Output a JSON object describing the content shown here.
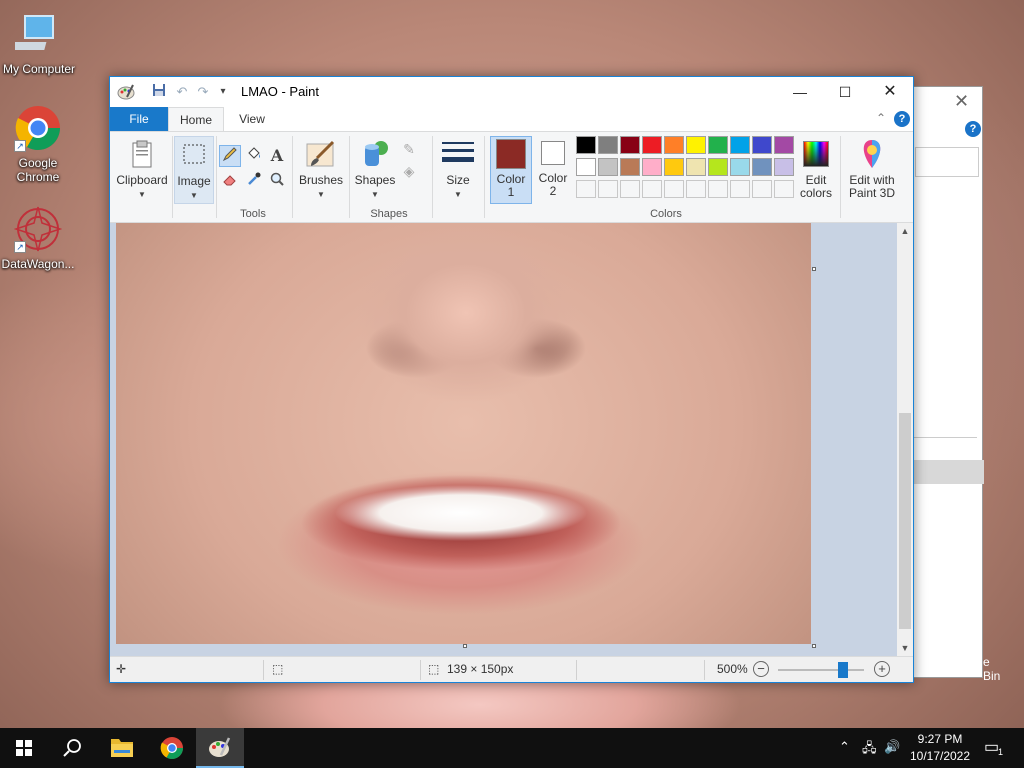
{
  "desktop": {
    "icons": [
      {
        "label": "My Computer"
      },
      {
        "label": "Google Chrome"
      },
      {
        "label": "DataWagon..."
      }
    ],
    "recycle_bin_label": "e Bin"
  },
  "paint": {
    "title": "LMAO - Paint",
    "tabs": {
      "file": "File",
      "home": "Home",
      "view": "View"
    },
    "ribbon": {
      "clipboard": "Clipboard",
      "image": "Image",
      "tools_group": "Tools",
      "brushes": "Brushes",
      "shapes": "Shapes",
      "shapes_group": "Shapes",
      "size": "Size",
      "color1": "Color 1",
      "color2": "Color 2",
      "colors_group": "Colors",
      "edit_colors": "Edit colors",
      "edit_paint3d": "Edit with Paint 3D",
      "text_tool": "A",
      "help": "?"
    },
    "colors": {
      "color1": "#8b2a25",
      "color2": "#ffffff",
      "row1": [
        "#000000",
        "#7f7f7f",
        "#880015",
        "#ed1c24",
        "#ff7f27",
        "#fff200",
        "#22b14c",
        "#00a2e8",
        "#3f48cc",
        "#a349a4"
      ],
      "row2": [
        "#ffffff",
        "#c3c3c3",
        "#b97a57",
        "#ffaec9",
        "#ffc90e",
        "#efe4b0",
        "#b5e61d",
        "#99d9ea",
        "#7092be",
        "#c8bfe7"
      ]
    },
    "status": {
      "image_size": "139 × 150px",
      "zoom": "500%"
    }
  },
  "taskbar": {
    "time": "9:27 PM",
    "date": "10/17/2022",
    "notification_count": "1"
  }
}
